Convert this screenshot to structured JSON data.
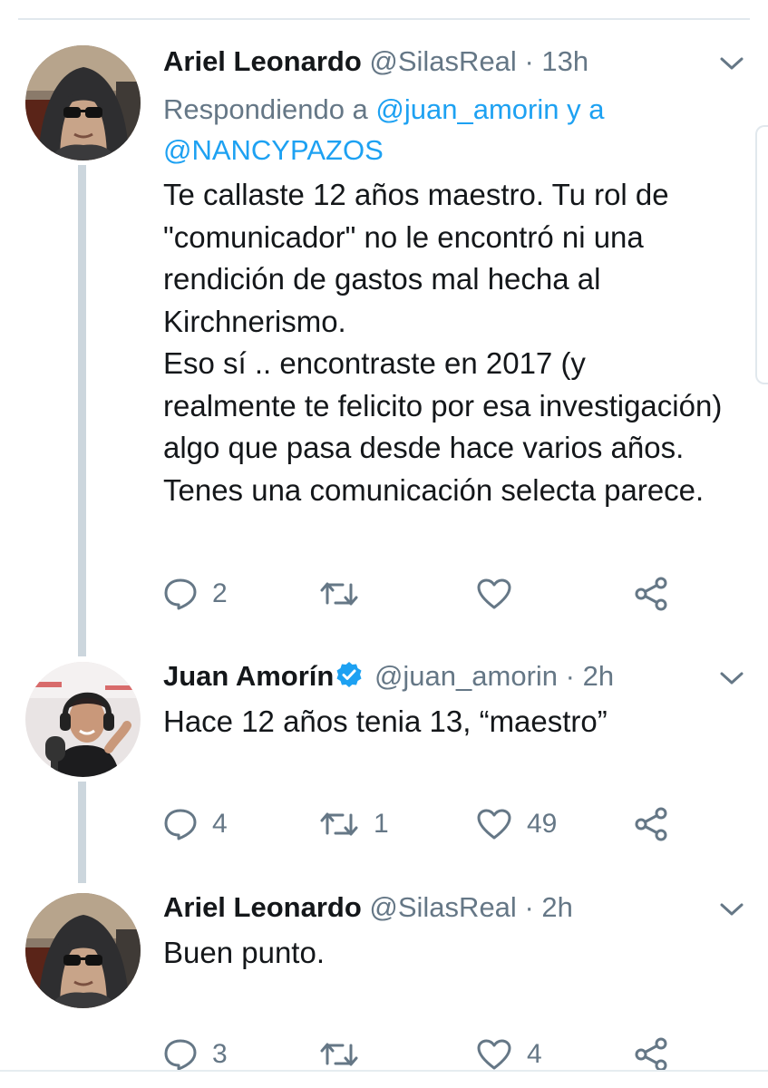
{
  "thread": [
    {
      "display_name": "Ariel  Leonardo",
      "handle": "@SilasReal",
      "separator": "·",
      "time": "13h",
      "verified": false,
      "replying_prefix": "Respondiendo a",
      "replying_mention_1": "@juan_amorin",
      "replying_conjunction": "y a",
      "replying_mention_2": "@NANCYPAZOS",
      "text_lines": [
        "Te callaste 12 años maestro. Tu rol de \"comunicador\" no le encontró ni una rendición de gastos mal hecha al Kirchnerismo.",
        "Eso sí .. encontraste en 2017 (y realmente te felicito por esa investigación) algo que pasa desde hace varios años. Tenes una comunicación selecta parece."
      ],
      "replies": "2",
      "retweets": "",
      "likes": "",
      "avatar_icon": "hooded-man-sunglasses"
    },
    {
      "display_name": "Juan Amorín",
      "handle": "@juan_amorin",
      "separator": "·",
      "time": "2h",
      "verified": true,
      "text": "Hace 12 años tenia 13, “maestro”",
      "replies": "4",
      "retweets": "1",
      "likes": "49",
      "avatar_icon": "man-with-headphones-microphone"
    },
    {
      "display_name": "Ariel  Leonardo",
      "handle": "@SilasReal",
      "separator": "·",
      "time": "2h",
      "verified": false,
      "text": "Buen punto.",
      "replies": "3",
      "retweets": "",
      "likes": "4",
      "avatar_icon": "hooded-man-sunglasses"
    }
  ],
  "icons": {
    "reply": "reply-icon",
    "retweet": "retweet-icon",
    "like": "heart-icon",
    "share": "share-icon",
    "menu": "chevron-down-icon",
    "verified": "verified-badge-icon"
  },
  "colors": {
    "text": "#14171a",
    "secondary": "#657786",
    "link": "#1da1f2",
    "thread_line": "#ccd6dd"
  }
}
